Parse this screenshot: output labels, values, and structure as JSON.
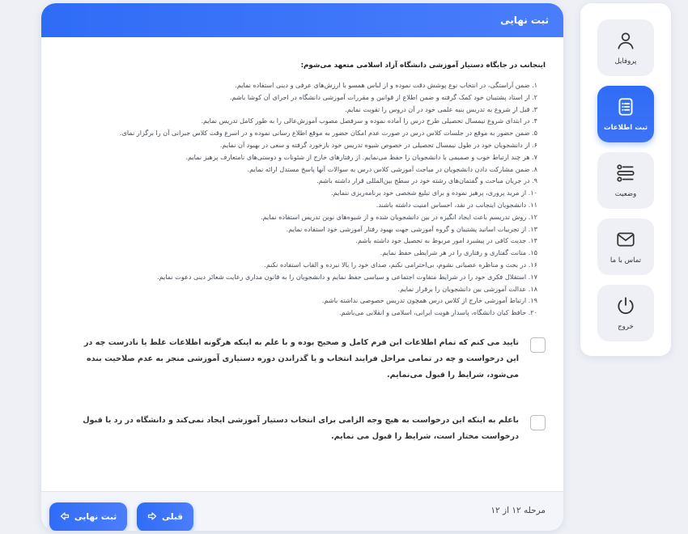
{
  "header": {
    "title": "ثبت نهایی"
  },
  "body": {
    "intro": "اینجانب در جایگاه دستیار آموزشی دانشگاه آزاد اسلامی متعهد می‌شوم:",
    "rules": [
      "۱. ضمن آراستگی، در انتخاب نوع پوشش دقت نموده و از لباس همسو با ارزش‌های عرفی و دینی استفاده نمایم.",
      "۲. از استاد پشتیبان خود کمک گرفته و ضمن اطلاع از قوانین و مقررات آموزشی دانشگاه در اجرای آن کوشا باشم.",
      "۳. قبل از شروع به تدریس بنیه علمی خود در آن دروس را تقویت نمایم.",
      "۴. در ابتدای شروع نیمسال تحصیلی طرح درس را آماده نموده و سرفصل مصوب آموزش‌عالی را به طور کامل تدریس نمایم.",
      "۵. ضمن حضور به موقع در جلسات کلاس درس در صورت عدم امکان حضور به موقع اطلاع رسانی نموده و در اسرع وقت کلاس جبرانی آن را برگزار نمای.",
      "۶. از دانشجویان خود در طول نیمسال تحصیلی در خصوص شیوه تدریس خود بازخورد گرفته و سعی در بهبود آن نمایم.",
      "۷. هر چند ارتباط خوب و صمیمی با دانشجویان را حفظ می‌نمایم. از رفتارهای خارج از شئونات و دوستی‌های نامتعارف پرهیز نمایم.",
      "۸. ضمن مشارکت دادن دانشجویان در مباحث آموزشی کلاس درس به سوالات آنها پاسخ مستدل ارائه نمایم.",
      "۹. در جریان مباحث و گفتمان‌های رشته خود در سطح بین‌المللی قرار داشته باشم.",
      "۱۰. از مرید پروری، پرهیز نموده و برای تبلیغ شخصی خود برنامه‌ریزی ننمایم.",
      "۱۱. دانشجویان اینجانب در نقد، احساس امنیت داشته باشند.",
      "۱۲. روش تدریسم باعث ایجاد انگیزه در بین دانشجویان شده و از شیوه‌های نوین تدریس استفاده نمایم.",
      "۱۳. از تجربیات اساتید پشتیبان و گروه آموزشی جهت بهبود رفتار آموزشی خود استفاده نمایم.",
      "۱۴. جدیت کافی در پیشبرد امور مربوط به تحصیل خود داشته باشم.",
      "۱۵. متانت گفتاری و رفتاری را در هر شرایطی حفظ نمایم.",
      "۱۶. در بحث و مناظره عصبانی نشوم، بی‌احترامی نکنم، صدای خود را بالا نبرده و القاب استفاده نکنم.",
      "۱۷. استقلال فکری خود را در شرایط متفاوت اجتماعی و سیاسی حفظ نمایم و دانشجویان را به قانون مداری رعایت شعائر دینی دعوت نمایم.",
      "۱۸. عدالت آموزشی بین دانشجویان را برقرار نمایم.",
      "۱۹. ارتباط آموزشی خارج از کلاس درس همچون تدریس خصوصی نداشته باشم.",
      "۲۰. حافظ کیان دانشگاه، پاسدار هویت ایرانی، اسلامی و انقلابی می‌باشم."
    ],
    "confirm1": "تایید می کنم که تمام اطلاعات این فرم کامل و صحیح بوده و با علم به اینکه هرگونه اطلاعات غلط یا نادرست چه در این درخواست و چه در تمامی مراحل فرایند انتخاب و یا گذراندن دوره دستیاری آموزشی منجر به عدم صلاحیت بنده می‌شود، شرایط را قبول می‌نمایم.",
    "confirm2": "باعلم به اینکه این درخواست به هیچ وجه الزامی برای انتخاب دستیار آموزشی ایجاد نمی‌کند و دانشگاه در رد یا قبول درخواست مختار است، شرایط را قبول می نمایم."
  },
  "footer": {
    "step_text": "مرحله ۱۲ از ۱۲",
    "prev_label": "قبلی",
    "final_label": "ثبت نهایی"
  },
  "sidebar": {
    "items": [
      {
        "label": "پروفایل",
        "icon": "user-icon",
        "active": false
      },
      {
        "label": "ثبت اطلاعات",
        "icon": "clipboard-list-icon",
        "active": true
      },
      {
        "label": "وضعیت",
        "icon": "list-status-icon",
        "active": false
      },
      {
        "label": "تماس با ما",
        "icon": "mail-icon",
        "active": false
      },
      {
        "label": "خروج",
        "icon": "power-icon",
        "active": false
      }
    ]
  },
  "colors": {
    "accent": "#2f6cf6",
    "background": "#eef0f6"
  }
}
